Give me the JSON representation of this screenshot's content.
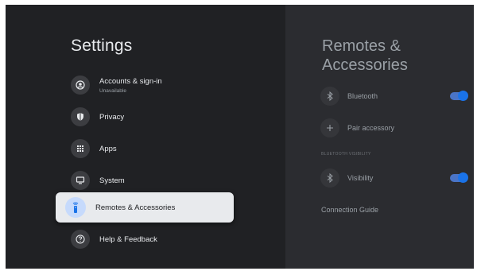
{
  "left": {
    "title": "Settings",
    "items": [
      {
        "label": "Accounts & sign-in",
        "sub": "Unavailable"
      },
      {
        "label": "Privacy"
      },
      {
        "label": "Apps"
      },
      {
        "label": "System"
      },
      {
        "label": "Remotes & Accessories",
        "selected": true
      },
      {
        "label": "Help & Feedback"
      }
    ]
  },
  "right": {
    "title": "Remotes & Accessories",
    "bluetooth": {
      "label": "Bluetooth",
      "enabled": true
    },
    "pair": {
      "label": "Pair accessory"
    },
    "visibility_section": "BLUETOOTH VISIBILITY",
    "visibility": {
      "label": "Visibility",
      "enabled": true
    },
    "guide": "Connection Guide"
  },
  "colors": {
    "accent": "#1a73e8",
    "selected_bg": "#e8eaed"
  }
}
